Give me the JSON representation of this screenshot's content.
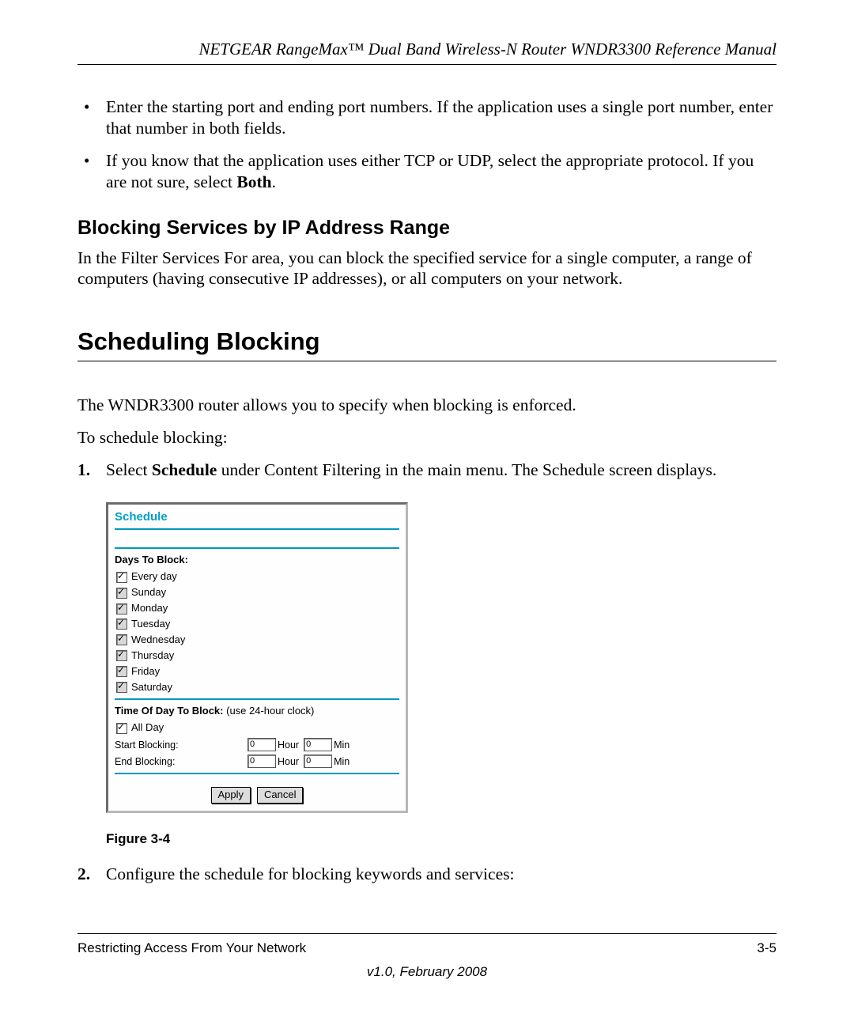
{
  "header": "NETGEAR RangeMax™ Dual Band Wireless-N Router WNDR3300 Reference Manual",
  "bullets": {
    "b1": "Enter the starting port and ending port numbers. If the application uses a single port number, enter that number in both fields.",
    "b2_pre": "If you know that the application uses either TCP or UDP, select the appropriate protocol. If you are not sure, select ",
    "b2_bold": "Both",
    "b2_post": "."
  },
  "sub_heading": "Blocking Services by IP Address Range",
  "sub_body": "In the Filter Services For area, you can block the specified service for a single computer, a range of computers (having consecutive IP addresses), or all computers on your network.",
  "main_heading": "Scheduling Blocking",
  "intro1": "The WNDR3300 router allows you to specify when blocking is enforced.",
  "intro2": "To schedule blocking:",
  "steps": {
    "s1_pre": "Select ",
    "s1_bold": "Schedule",
    "s1_post": " under Content Filtering in the main menu. The Schedule screen displays.",
    "s2": "Configure the schedule for blocking keywords and services:"
  },
  "nums": {
    "n1": "1.",
    "n2": "2."
  },
  "panel": {
    "title": "Schedule",
    "days_label": "Days To Block:",
    "days": {
      "every": "Every day",
      "sun": "Sunday",
      "mon": "Monday",
      "tue": "Tuesday",
      "wed": "Wednesday",
      "thu": "Thursday",
      "fri": "Friday",
      "sat": "Saturday"
    },
    "time_label": "Time Of Day To Block: ",
    "time_hint": "(use 24-hour clock)",
    "allday": "All Day",
    "start": "Start Blocking:",
    "end": "End Blocking:",
    "hour": "Hour",
    "min": "Min",
    "val0": "0",
    "apply": "Apply",
    "cancel": "Cancel"
  },
  "figure_caption": "Figure 3-4",
  "footer": {
    "left": "Restricting Access From Your Network",
    "right": "3-5",
    "version": "v1.0, February 2008"
  }
}
